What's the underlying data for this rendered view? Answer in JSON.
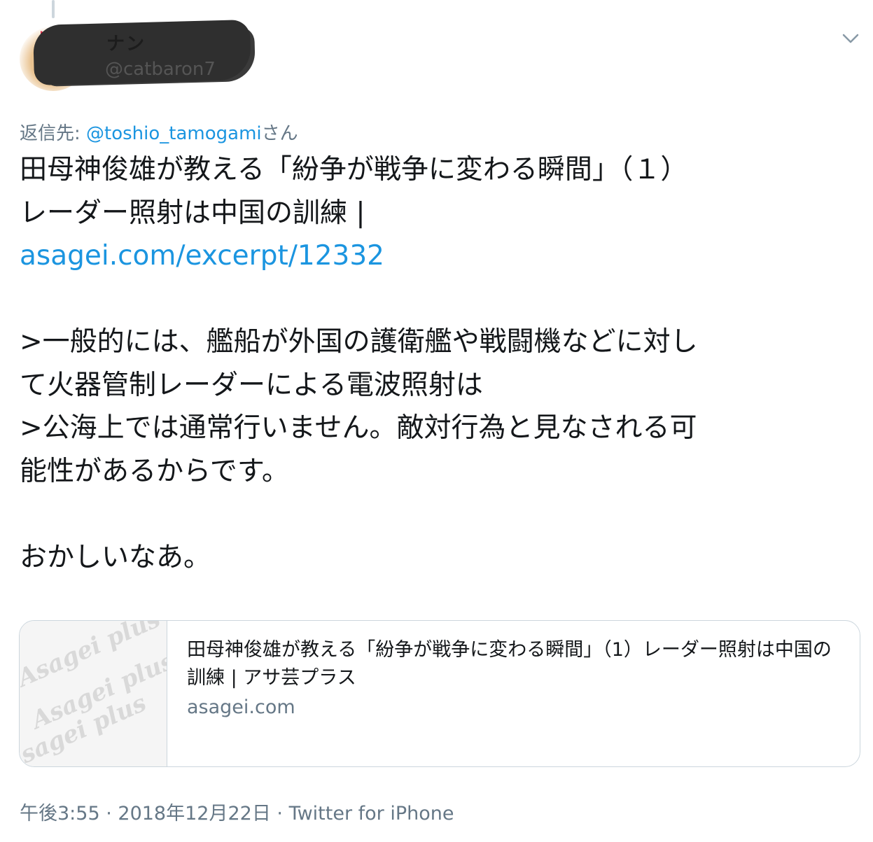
{
  "user": {
    "display_name": "ナン",
    "handle": "@catbaron7"
  },
  "reply": {
    "prefix": "返信先: ",
    "mention": "@toshio_tamogami",
    "suffix": "さん"
  },
  "tweet": {
    "line1": "田母神俊雄が教える「紛争が戦争に変わる瞬間」（１）",
    "line2": "レーダー照射は中国の訓練 |",
    "link": "asagei.com/excerpt/12332",
    "quote1": ">一般的には、艦船が外国の護衛艦や戦闘機などに対し",
    "quote2": "て火器管制レーダーによる電波照射は",
    "quote3": ">公海上では通常行いません。敵対行為と見なされる可",
    "quote4": "能性があるからです。",
    "comment": "おかしいなあ。"
  },
  "card": {
    "title": "田母神俊雄が教える「紛争が戦争に変わる瞬間」（1）レーダー照射は中国の訓練 | アサ芸プラス",
    "domain": "asagei.com",
    "thumb_text": "Asagei plus"
  },
  "meta": {
    "time": "午後3:55",
    "sep": " · ",
    "date": "2018年12月22日",
    "client": "Twitter for iPhone"
  },
  "colors": {
    "link": "#1b95e0",
    "secondary": "#657786",
    "border": "#ccd6dd"
  }
}
